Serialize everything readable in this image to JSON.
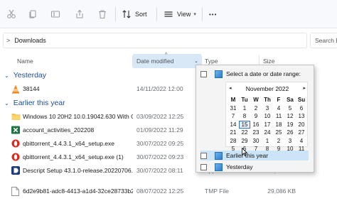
{
  "toolbar": {
    "sort_label": "Sort",
    "view_label": "View",
    "more_label": "•••"
  },
  "address": {
    "chevron": ">",
    "breadcrumb": "Downloads",
    "search_placeholder": "Search D"
  },
  "columns": {
    "name": "Name",
    "date_modified": "Date modified",
    "type": "Type",
    "size": "Size"
  },
  "groups": {
    "yesterday": "Yesterday",
    "earlier_this_year": "Earlier this year"
  },
  "files": [
    {
      "name": "38144",
      "date": "14/11/2022 12:00",
      "type": "",
      "size": "",
      "icon": "vlc-icon"
    },
    {
      "name": "Windows 10 20H2 10.0.19042.630 With Of...",
      "date": "03/09/2022 12:25",
      "type": "",
      "size": "",
      "icon": "folder-icon"
    },
    {
      "name": "account_activities_202208",
      "date": "01/09/2022 11:29",
      "type": "",
      "size": "",
      "icon": "excel-icon"
    },
    {
      "name": "qbittorrent_4.4.3.1_x64_setup.exe",
      "date": "30/07/2022 09:25",
      "type": "",
      "size": "",
      "icon": "opera-icon"
    },
    {
      "name": "qbittorrent_4.4.3.1_x64_setup.exe (1)",
      "date": "30/07/2022 09:23",
      "type": "",
      "size": "",
      "icon": "opera-icon"
    },
    {
      "name": "Descript Setup 43.1.0-release.20220706.19",
      "date": "30/07/2022 08:11",
      "type": "Application",
      "size": "163,642 KB",
      "icon": "descript-icon"
    },
    {
      "name": "6d2e9b81-adc8-4413-a1d4-32ce28733b21...",
      "date": "08/07/2022 12:25",
      "type": "TMP File",
      "size": "29,086 KB",
      "icon": "file-icon"
    }
  ],
  "filter_popup": {
    "date_range_label": "Select a date or date range:",
    "calendar": {
      "month_title": "November 2022",
      "prev": "◂",
      "next": "▸",
      "weekday_headers": [
        "M",
        "Tu",
        "W",
        "Th",
        "F",
        "Sa",
        "Su"
      ],
      "weeks": [
        [
          "31",
          "1",
          "2",
          "3",
          "4",
          "5",
          "6"
        ],
        [
          "7",
          "8",
          "9",
          "10",
          "11",
          "12",
          "13"
        ],
        [
          "14",
          "15",
          "16",
          "17",
          "18",
          "19",
          "20"
        ],
        [
          "21",
          "22",
          "23",
          "24",
          "25",
          "26",
          "27"
        ],
        [
          "28",
          "29",
          "30",
          "1",
          "2",
          "3",
          "4"
        ],
        [
          "5",
          "6",
          "7",
          "8",
          "9",
          "10",
          "11"
        ]
      ],
      "today": "15"
    },
    "options": [
      "Earlier this year",
      "Yesterday"
    ]
  },
  "colors": {
    "accent": "#2d6fc7",
    "group_header": "#1e4f94",
    "selection": "#cce4f7"
  }
}
